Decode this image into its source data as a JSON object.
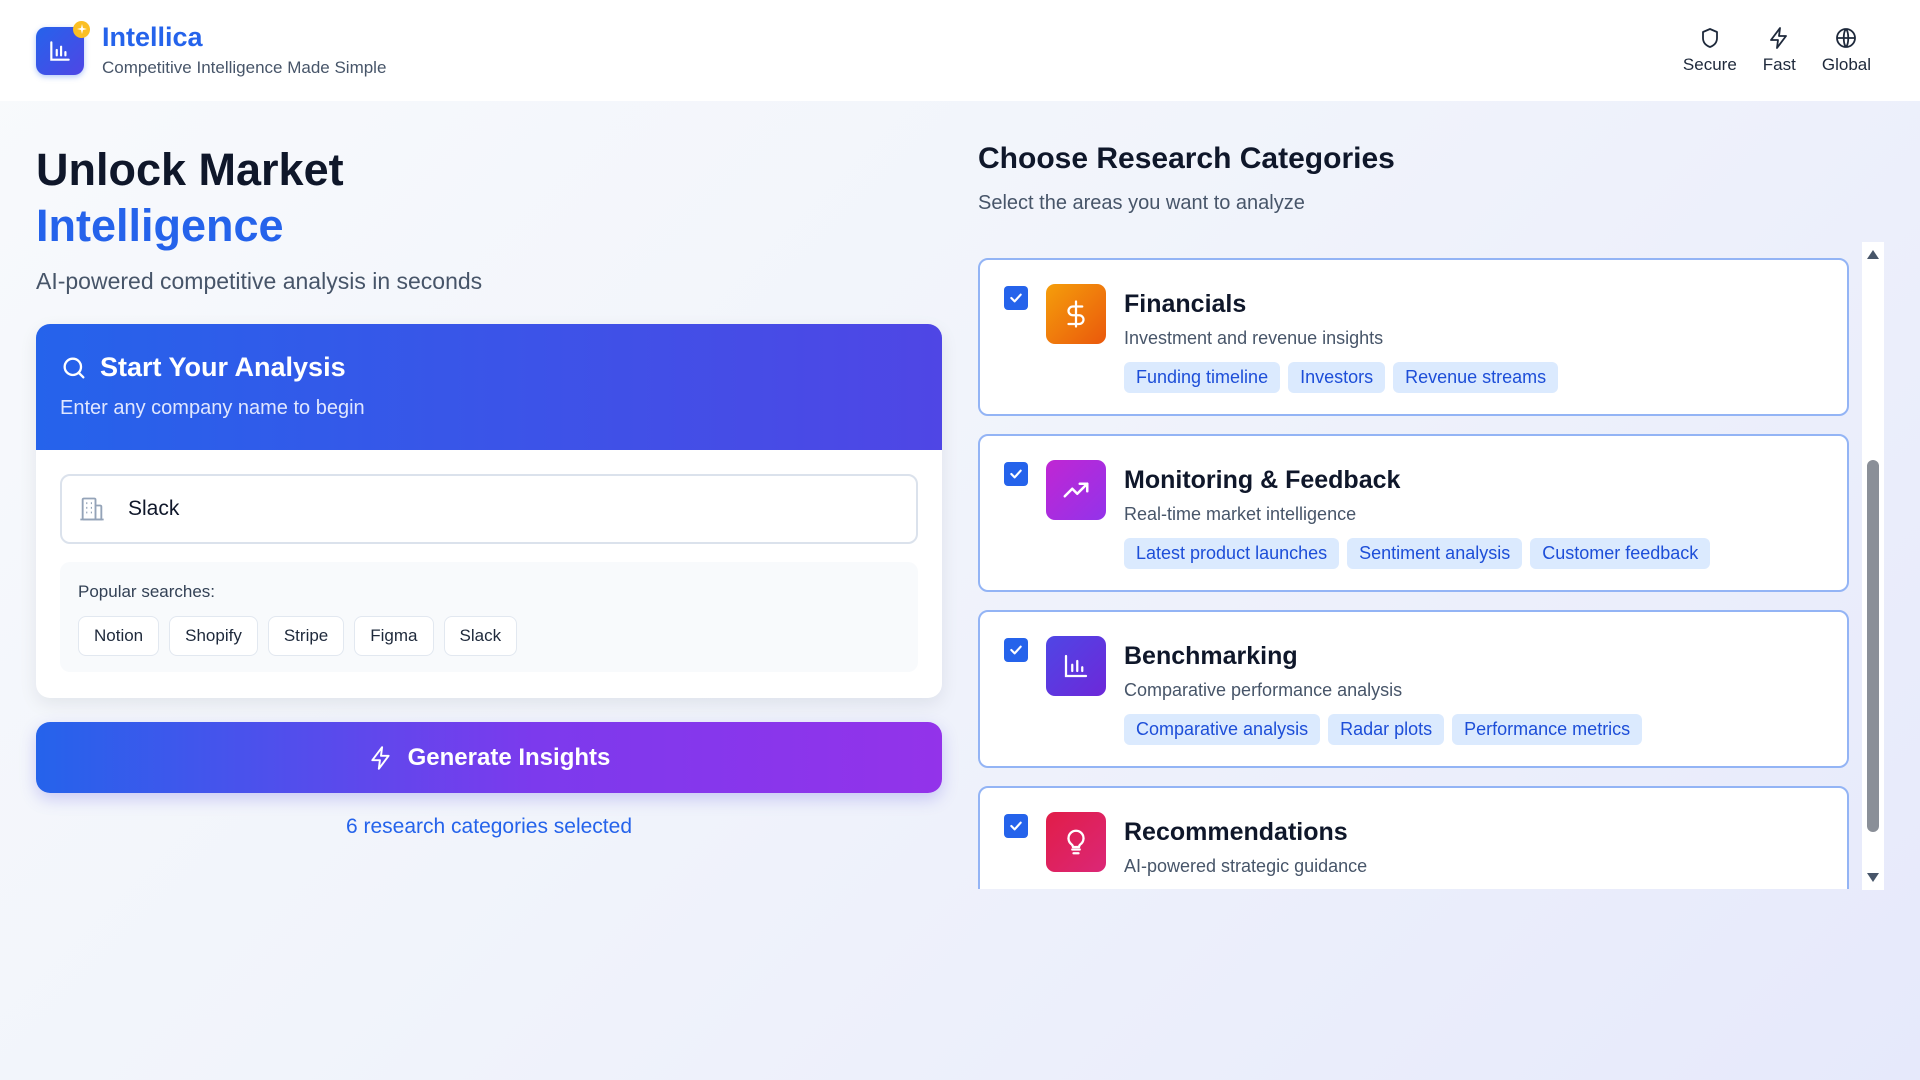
{
  "header": {
    "brand_name": "Intellica",
    "brand_tagline": "Competitive Intelligence Made Simple",
    "nav": [
      {
        "label": "Secure",
        "icon": "shield-icon"
      },
      {
        "label": "Fast",
        "icon": "zap-icon"
      },
      {
        "label": "Global",
        "icon": "globe-icon"
      }
    ]
  },
  "hero": {
    "line1": "Unlock Market",
    "line2": "Intelligence",
    "subtitle": "AI-powered competitive analysis in seconds"
  },
  "analysis": {
    "title": "Start Your Analysis",
    "subtitle": "Enter any company name to begin",
    "company_value": "Slack",
    "popular_label": "Popular searches:",
    "popular": [
      "Notion",
      "Shopify",
      "Stripe",
      "Figma",
      "Slack"
    ]
  },
  "generate": {
    "label": "Generate Insights",
    "selected_text": "6 research categories selected"
  },
  "categories": {
    "title": "Choose Research Categories",
    "subtitle": "Select the areas you want to analyze",
    "items": [
      {
        "name": "Financials",
        "desc": "Investment and revenue insights",
        "tags": [
          "Funding timeline",
          "Investors",
          "Revenue streams"
        ],
        "checked": true,
        "icon": "dollar-icon",
        "color_from": "#f59e0b",
        "color_to": "#ea580c"
      },
      {
        "name": "Monitoring & Feedback",
        "desc": "Real-time market intelligence",
        "tags": [
          "Latest product launches",
          "Sentiment analysis",
          "Customer feedback"
        ],
        "checked": true,
        "icon": "trending-up-icon",
        "color_from": "#c026d3",
        "color_to": "#9333ea"
      },
      {
        "name": "Benchmarking",
        "desc": "Comparative performance analysis",
        "tags": [
          "Comparative analysis",
          "Radar plots",
          "Performance metrics"
        ],
        "checked": true,
        "icon": "bar-chart-icon",
        "color_from": "#4f46e5",
        "color_to": "#6d28d9"
      },
      {
        "name": "Recommendations",
        "desc": "AI-powered strategic guidance",
        "tags": [],
        "checked": true,
        "icon": "lightbulb-icon",
        "color_from": "#e11d48",
        "color_to": "#db2777"
      }
    ]
  },
  "colors": {
    "accent": "#2563eb",
    "tag_bg": "#dbeafe",
    "tag_text": "#1d4ed8"
  }
}
